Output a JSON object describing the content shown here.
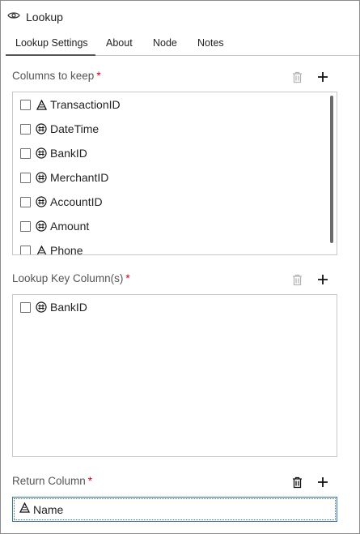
{
  "window": {
    "title": "Lookup",
    "title_icon": "lookup-eye-icon"
  },
  "tabs": [
    {
      "label": "Lookup Settings",
      "active": true
    },
    {
      "label": "About",
      "active": false
    },
    {
      "label": "Node",
      "active": false
    },
    {
      "label": "Notes",
      "active": false
    }
  ],
  "columns_to_keep": {
    "label": "Columns to keep",
    "required_mark": "*",
    "delete_enabled": false,
    "items": [
      {
        "label": "TransactionID",
        "type_icon": "character-column-icon",
        "checked": false
      },
      {
        "label": "DateTime",
        "type_icon": "numeric-column-icon",
        "checked": false
      },
      {
        "label": "BankID",
        "type_icon": "numeric-column-icon",
        "checked": false
      },
      {
        "label": "MerchantID",
        "type_icon": "numeric-column-icon",
        "checked": false
      },
      {
        "label": "AccountID",
        "type_icon": "numeric-column-icon",
        "checked": false
      },
      {
        "label": "Amount",
        "type_icon": "numeric-column-icon",
        "checked": false
      },
      {
        "label": "Phone",
        "type_icon": "character-column-icon",
        "checked": false
      }
    ]
  },
  "lookup_key_columns": {
    "label": "Lookup Key Column(s)",
    "required_mark": "*",
    "delete_enabled": false,
    "items": [
      {
        "label": "BankID",
        "type_icon": "numeric-column-icon",
        "checked": false
      }
    ]
  },
  "return_column": {
    "label": "Return Column",
    "required_mark": "*",
    "delete_enabled": true,
    "value": {
      "label": "Name",
      "type_icon": "character-column-icon"
    }
  },
  "colors": {
    "required": "#d0021b",
    "focus_border": "#3b6fb5",
    "disabled_icon": "#b5b5b5"
  }
}
